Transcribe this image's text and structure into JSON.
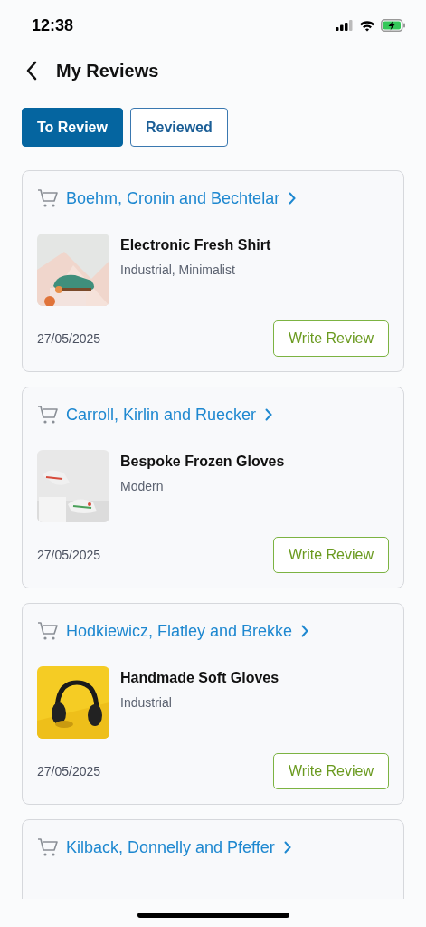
{
  "status_bar": {
    "time": "12:38"
  },
  "header": {
    "title": "My Reviews"
  },
  "tabs": [
    {
      "label": "To Review",
      "selected": true
    },
    {
      "label": "Reviewed",
      "selected": false
    }
  ],
  "orders": [
    {
      "vendor": "Boehm, Cronin and Bechtelar",
      "product": {
        "name": "Electronic Fresh Shirt",
        "tags": "Industrial, Minimalist"
      },
      "date": "27/05/2025",
      "action": "Write Review"
    },
    {
      "vendor": "Carroll, Kirlin and Ruecker",
      "product": {
        "name": "Bespoke Frozen Gloves",
        "tags": "Modern"
      },
      "date": "27/05/2025",
      "action": "Write Review"
    },
    {
      "vendor": "Hodkiewicz, Flatley and Brekke",
      "product": {
        "name": "Handmade Soft Gloves",
        "tags": "Industrial"
      },
      "date": "27/05/2025",
      "action": "Write Review"
    },
    {
      "vendor": "Kilback, Donnelly and Pfeffer"
    }
  ]
}
